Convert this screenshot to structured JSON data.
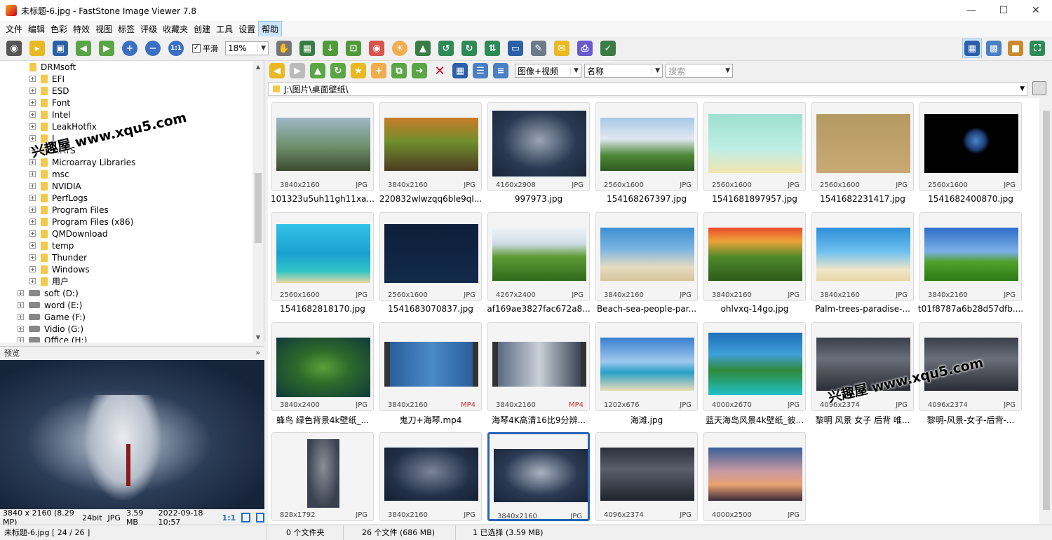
{
  "window": {
    "title": "未标题-6.jpg  -  FastStone Image Viewer 7.8"
  },
  "menu": [
    "文件",
    "编辑",
    "色彩",
    "特效",
    "视图",
    "标签",
    "评级",
    "收藏夹",
    "创建",
    "工具",
    "设置",
    "帮助"
  ],
  "toolbar": {
    "smooth_label": "平滑",
    "zoom_value": "18%"
  },
  "tree": {
    "folders": [
      "DRMsoft",
      "EFI",
      "ESD",
      "Font",
      "Intel",
      "LeakHotfix",
      "L...",
      "...ATS",
      "Microarray Libraries",
      "msc",
      "NVIDIA",
      "PerfLogs",
      "Program Files",
      "Program Files (x86)",
      "QMDownload",
      "temp",
      "Thunder",
      "Windows",
      "用户"
    ],
    "drives": [
      "soft (D:)",
      "word (E:)",
      "Game (F:)",
      "Vidio (G:)",
      "Office (H:)"
    ]
  },
  "preview": {
    "header": "预览",
    "info": {
      "resolution": "3840 x 2160 (8.29 MP)",
      "depth": "24bit",
      "format": "JPG",
      "size": "3.59 MB",
      "date": "2022-09-18 10:57",
      "ratio": "1:1"
    }
  },
  "nav": {
    "filter": "图像+视频",
    "sort": "名称",
    "search_placeholder": "搜索",
    "path": "J:\\图片\\桌面壁纸\\"
  },
  "thumbnails": [
    {
      "dims": "3840x2160",
      "ext": "JPG",
      "name": "101323u5uh11gh11xa..."
    },
    {
      "dims": "3840x2160",
      "ext": "JPG",
      "name": "220832wlwzqq6ble9ql..."
    },
    {
      "dims": "4160x2908",
      "ext": "JPG",
      "name": "997973.jpg"
    },
    {
      "dims": "2560x1600",
      "ext": "JPG",
      "name": "154168267397.jpg"
    },
    {
      "dims": "2560x1600",
      "ext": "JPG",
      "name": "1541681897957.jpg"
    },
    {
      "dims": "2560x1600",
      "ext": "JPG",
      "name": "1541682231417.jpg"
    },
    {
      "dims": "2560x1600",
      "ext": "JPG",
      "name": "1541682400870.jpg"
    },
    {
      "dims": "2560x1600",
      "ext": "JPG",
      "name": "1541682818170.jpg"
    },
    {
      "dims": "2560x1600",
      "ext": "JPG",
      "name": "1541683070837.jpg"
    },
    {
      "dims": "4267x2400",
      "ext": "JPG",
      "name": "af169ae3827fac672a8..."
    },
    {
      "dims": "3840x2160",
      "ext": "JPG",
      "name": "Beach-sea-people-par..."
    },
    {
      "dims": "3840x2160",
      "ext": "JPG",
      "name": "ohlvxq-14go.jpg"
    },
    {
      "dims": "3840x2160",
      "ext": "JPG",
      "name": "Palm-trees-paradise-..."
    },
    {
      "dims": "3840x2160",
      "ext": "JPG",
      "name": "t01f8787a6b28d57dfb...."
    },
    {
      "dims": "3840x2400",
      "ext": "JPG",
      "name": "蜂鸟 绿色背景4k壁纸_..."
    },
    {
      "dims": "3840x2160",
      "ext": "MP4",
      "name": "鬼刀+海琴.mp4"
    },
    {
      "dims": "3840x2160",
      "ext": "MP4",
      "name": "海琴4K高清16比9分辨..."
    },
    {
      "dims": "1202x676",
      "ext": "JPG",
      "name": "海滩.jpg"
    },
    {
      "dims": "4000x2670",
      "ext": "JPG",
      "name": "蓝天海岛风景4k壁纸_彼..."
    },
    {
      "dims": "4096x2374",
      "ext": "JPG",
      "name": "黎明 风景 女子 后背 唯..."
    },
    {
      "dims": "4096x2374",
      "ext": "JPG",
      "name": "黎明-风景-女子-后背-..."
    },
    {
      "dims": "828x1792",
      "ext": "JPG",
      "name": ""
    },
    {
      "dims": "3840x2160",
      "ext": "JPG",
      "name": ""
    },
    {
      "dims": "3840x2160",
      "ext": "JPG",
      "name": ""
    },
    {
      "dims": "4096x2374",
      "ext": "JPG",
      "name": ""
    },
    {
      "dims": "4000x2500",
      "ext": "JPG",
      "name": ""
    }
  ],
  "status": {
    "file": "未标题-6.jpg [ 24 / 26 ]",
    "folders": "0 个文件夹",
    "files": "26 个文件 (686 MB)",
    "selected": "1 已选择 (3.59 MB)"
  },
  "watermark": "兴趣屋 www.xqu5.com",
  "colors": {
    "selection": "#2a64b8",
    "video_ext": "#c0392b",
    "menu_active": "#cce4f7"
  }
}
